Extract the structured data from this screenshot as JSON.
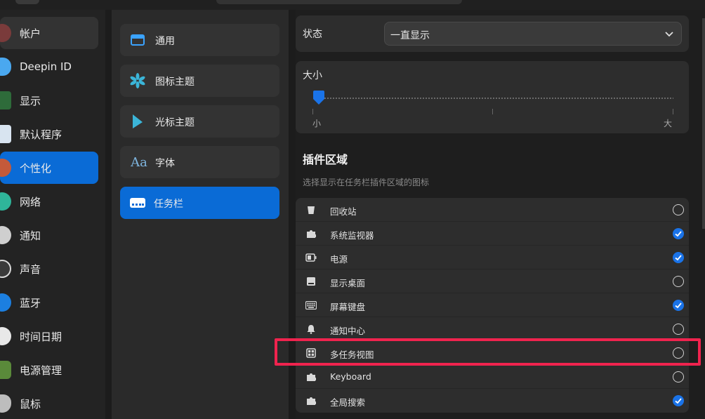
{
  "left_nav": {
    "items": [
      {
        "label": "帐户",
        "icon": "account-avatar-icon",
        "state": "hover"
      },
      {
        "label": "Deepin ID",
        "icon": "cloud-icon",
        "state": ""
      },
      {
        "label": "显示",
        "icon": "display-icon",
        "state": ""
      },
      {
        "label": "默认程序",
        "icon": "default-apps-icon",
        "state": ""
      },
      {
        "label": "个性化",
        "icon": "personalization-icon",
        "state": "active"
      },
      {
        "label": "网络",
        "icon": "network-globe-icon",
        "state": ""
      },
      {
        "label": "通知",
        "icon": "bell-icon",
        "state": ""
      },
      {
        "label": "声音",
        "icon": "speaker-icon",
        "state": ""
      },
      {
        "label": "蓝牙",
        "icon": "bluetooth-icon",
        "state": ""
      },
      {
        "label": "时间日期",
        "icon": "clock-icon",
        "state": ""
      },
      {
        "label": "电源管理",
        "icon": "battery-icon",
        "state": ""
      },
      {
        "label": "鼠标",
        "icon": "mouse-icon",
        "state": ""
      }
    ]
  },
  "mid_nav": {
    "items": [
      {
        "label": "通用",
        "icon": "window-icon",
        "active": false
      },
      {
        "label": "图标主题",
        "icon": "icon-theme-icon",
        "active": false
      },
      {
        "label": "光标主题",
        "icon": "cursor-icon",
        "active": false
      },
      {
        "label": "字体",
        "icon": "font-icon",
        "active": false
      },
      {
        "label": "任务栏",
        "icon": "taskbar-icon",
        "active": true
      }
    ],
    "font_glyph": "Aa"
  },
  "status": {
    "label": "状态",
    "value": "一直显示"
  },
  "size": {
    "label": "大小",
    "min_label": "小",
    "max_label": "大",
    "value_fraction": 0.0
  },
  "plugins": {
    "title": "插件区域",
    "description": "选择显示在任务栏插件区域的图标",
    "items": [
      {
        "label": "回收站",
        "icon": "trash-icon",
        "checked": false
      },
      {
        "label": "系统监视器",
        "icon": "puzzle-icon",
        "checked": true
      },
      {
        "label": "电源",
        "icon": "battery-icon",
        "checked": true
      },
      {
        "label": "显示桌面",
        "icon": "desktop-icon",
        "checked": false
      },
      {
        "label": "屏幕键盘",
        "icon": "keyboard-icon",
        "checked": true
      },
      {
        "label": "通知中心",
        "icon": "bell-icon",
        "checked": false
      },
      {
        "label": "多任务视图",
        "icon": "multitask-view-icon",
        "checked": false
      },
      {
        "label": "Keyboard",
        "icon": "puzzle-icon",
        "checked": false
      },
      {
        "label": "全局搜索",
        "icon": "puzzle-icon",
        "checked": true
      }
    ]
  },
  "colors": {
    "accent": "#0a6bd6",
    "checkbox_on": "#1a73e8",
    "highlight": "#f0234e"
  }
}
